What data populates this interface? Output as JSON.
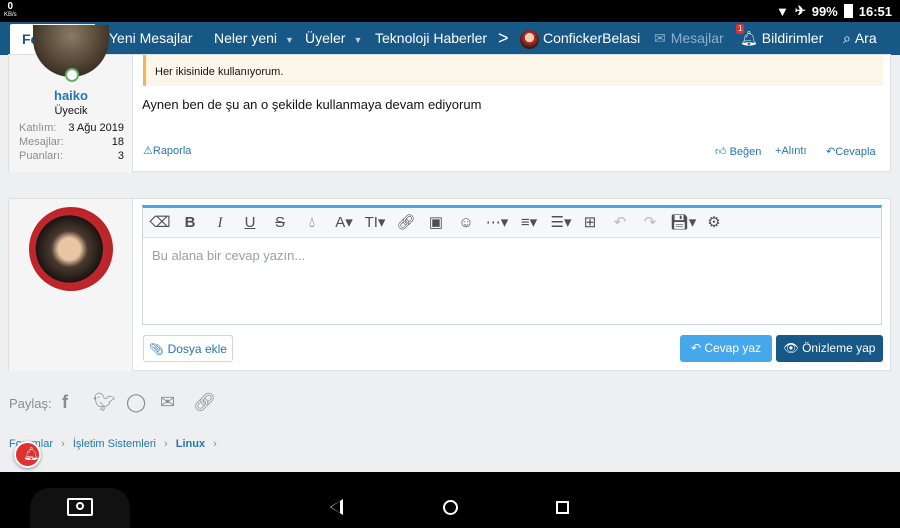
{
  "status_bar": {
    "speed_value": "0",
    "speed_unit": "KB/s",
    "battery": "99%",
    "time": "16:51"
  },
  "nav": {
    "forums": "Forumlar",
    "new_posts": "Yeni Mesajlar",
    "whats_new": "Neler yeni",
    "members": "Üyeler",
    "tech_news": "Teknoloji Haberleri",
    "more": ">",
    "user": "ConfickerBelasi",
    "messages": "Mesajlar",
    "alerts": "Bildirimler",
    "alerts_badge": "1",
    "search": "Ara"
  },
  "post": {
    "username": "haiko",
    "role": "Üyecik",
    "joined_label": "Katılım:",
    "joined_value": "3 Ağu 2019",
    "messages_label": "Mesajlar:",
    "messages_value": "18",
    "points_label": "Puanları:",
    "points_value": "3",
    "quote": "Her ikisinide kullanıyorum.",
    "body": "Aynen ben de şu an o şekilde kullanmaya devam ediyorum",
    "report": "Raporla",
    "like": "Beğen",
    "quote_action": "Alıntı",
    "reply": "Cevapla"
  },
  "editor": {
    "placeholder": "Bu alana bir cevap yazın...",
    "attach": "Dosya ekle",
    "submit": "Cevap yaz",
    "preview": "Önizleme yap"
  },
  "share": {
    "label": "Paylaş:"
  },
  "breadcrumb": [
    "Forumlar",
    "İşletim Sistemleri",
    "Linux"
  ]
}
